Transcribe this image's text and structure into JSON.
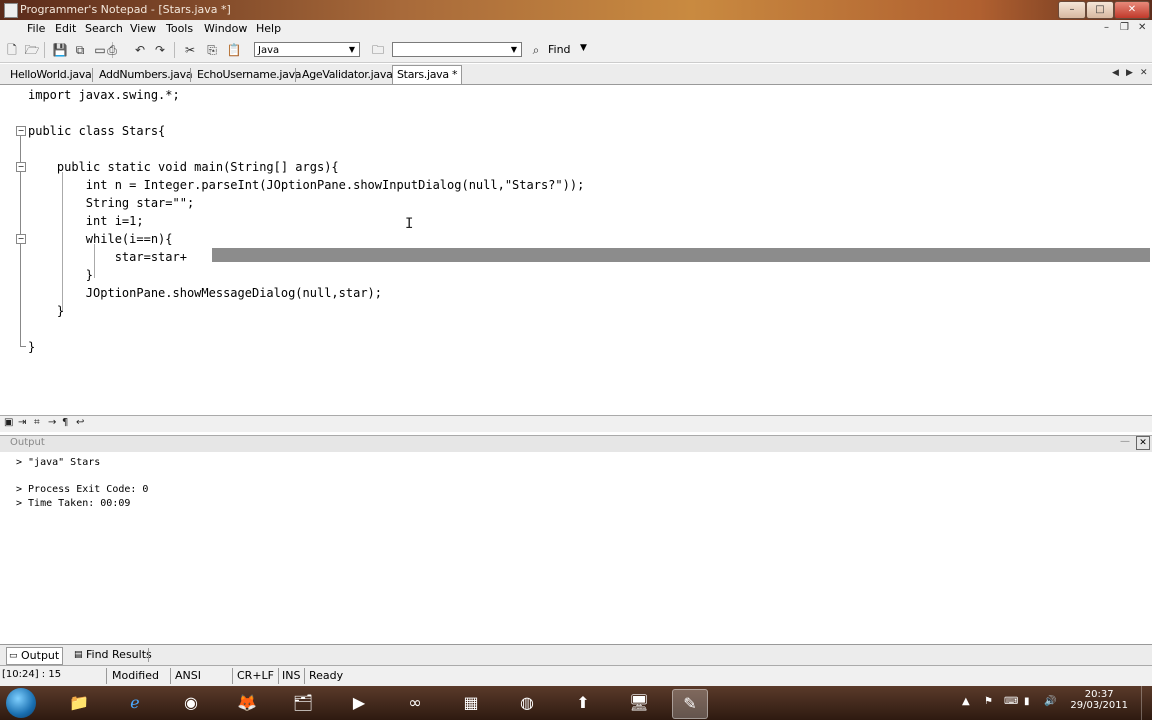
{
  "window": {
    "title": "Programmer's Notepad - [Stars.java *]",
    "controls": [
      "–",
      "□",
      "✕"
    ]
  },
  "menu": {
    "items": [
      "File",
      "Edit",
      "View",
      "Search",
      "Tools",
      "Window",
      "Help"
    ]
  },
  "toolbar": {
    "scheme_value": "Java",
    "find_value": "",
    "find_label": "Find"
  },
  "tabs": [
    {
      "label": "HelloWorld.java",
      "active": false
    },
    {
      "label": "AddNumbers.java",
      "active": false
    },
    {
      "label": "EchoUsername.java",
      "active": false
    },
    {
      "label": "AgeValidator.java",
      "active": false
    },
    {
      "label": "Stars.java *",
      "active": true
    }
  ],
  "code": [
    "import javax.swing.*;",
    "",
    "public class Stars{",
    "",
    "    public static void main(String[] args){",
    "        int n = Integer.parseInt(JOptionPane.showInputDialog(null,\"Stars?\"));",
    "        String star=\"\";",
    "        int i=1;",
    "        while(i==n){",
    "            star=star+",
    "        }",
    "        JOptionPane.showMessageDialog(null,star);",
    "    }",
    "",
    "}"
  ],
  "output": {
    "header": "Output",
    "lines": [
      "> \"java\" Stars",
      "",
      "> Process Exit Code: 0",
      "> Time Taken: 00:09"
    ]
  },
  "output_tabs": [
    "Output",
    "Find Results"
  ],
  "status": {
    "position": "[10:24] : 15",
    "modified": "Modified",
    "encoding": "ANSI",
    "eol": "CR+LF",
    "ins": "INS",
    "state": "Ready"
  },
  "taskbar": {
    "time": "20:37",
    "date": "29/03/2011"
  }
}
